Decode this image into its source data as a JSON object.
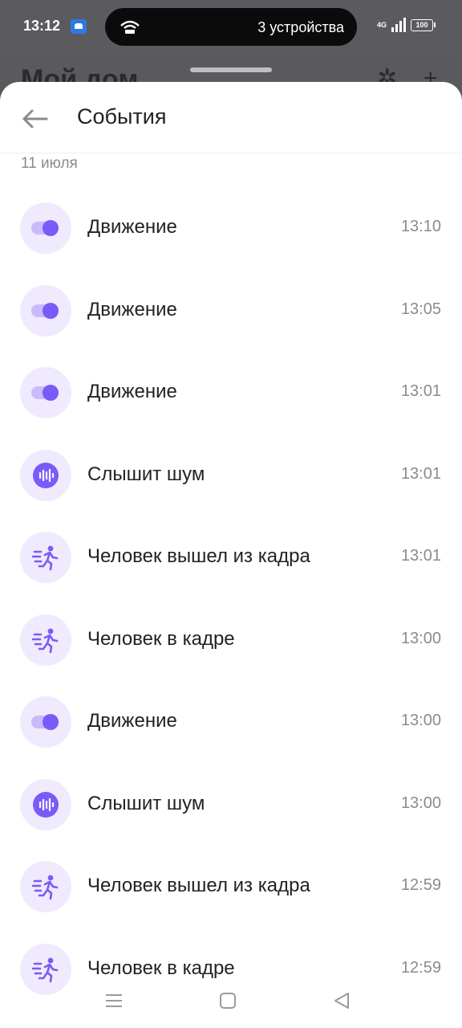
{
  "status_bar": {
    "time": "13:12",
    "island_text": "3 устройства",
    "network": "4G",
    "battery": "100"
  },
  "background": {
    "title": "Мой дом"
  },
  "sheet": {
    "title": "События",
    "date": "11 июля"
  },
  "events": [
    {
      "label": "Движение",
      "time": "13:10",
      "icon": "motion-toggle-icon"
    },
    {
      "label": "Движение",
      "time": "13:05",
      "icon": "motion-toggle-icon"
    },
    {
      "label": "Движение",
      "time": "13:01",
      "icon": "motion-toggle-icon"
    },
    {
      "label": "Слышит шум",
      "time": "13:01",
      "icon": "sound-wave-icon"
    },
    {
      "label": "Человек вышел из кадра",
      "time": "13:01",
      "icon": "running-person-icon"
    },
    {
      "label": "Человек в кадре",
      "time": "13:00",
      "icon": "running-person-icon"
    },
    {
      "label": "Движение",
      "time": "13:00",
      "icon": "motion-toggle-icon"
    },
    {
      "label": "Слышит шум",
      "time": "13:00",
      "icon": "sound-wave-icon"
    },
    {
      "label": "Человек вышел из кадра",
      "time": "12:59",
      "icon": "running-person-icon"
    },
    {
      "label": "Человек в кадре",
      "time": "12:59",
      "icon": "running-person-icon"
    }
  ],
  "colors": {
    "accent": "#7a5af8",
    "icon_bg": "#efeafd"
  }
}
